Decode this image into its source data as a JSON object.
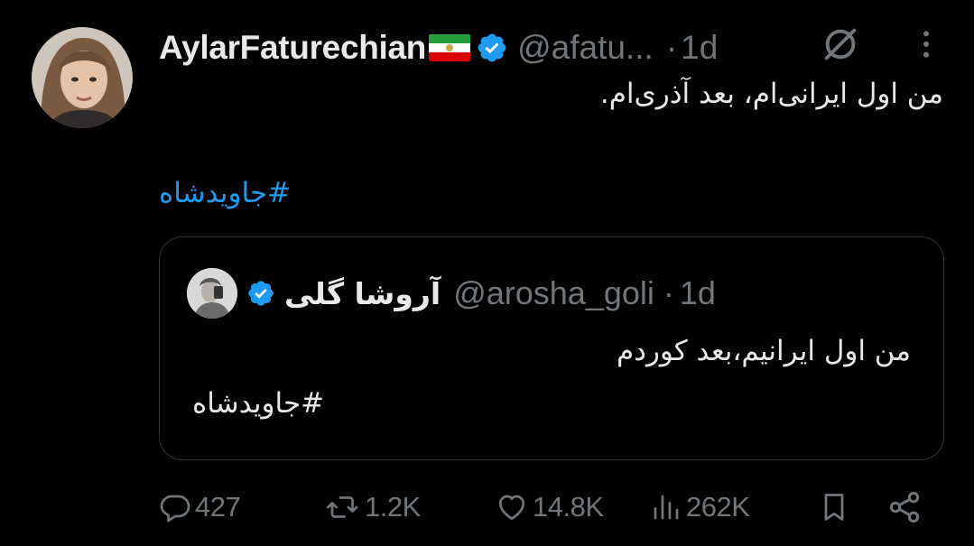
{
  "tweet": {
    "author": {
      "display_name": "AylarFaturechian",
      "flag_emoji": "Iran (Lion and Sun) flag",
      "verified": true,
      "handle": "@afatu...",
      "separator": "·",
      "time": "1d"
    },
    "text": "من اول ایرانی‌ام، بعد آذری‌ام.",
    "hashtag": "#جاویدشاه",
    "quote": {
      "author": {
        "display_name": "آروشا گلی",
        "verified": true,
        "handle": "@arosha_goli",
        "separator": "·",
        "time": "1d"
      },
      "text": "من اول ایرانیم،بعد کوردم",
      "hashtag": "#جاویدشاه"
    },
    "metrics": {
      "replies": "427",
      "reposts": "1.2K",
      "likes": "14.8K",
      "views": "262K"
    }
  },
  "icons": {
    "header": [
      "grok-icon",
      "more-icon"
    ],
    "actions": [
      "reply-icon",
      "repost-icon",
      "like-icon",
      "views-icon",
      "bookmark-icon",
      "share-icon"
    ]
  },
  "colors": {
    "background": "#000000",
    "text": "#e7e9ea",
    "secondary": "#71767b",
    "accent": "#1d9bf0",
    "border": "#2f3336"
  }
}
